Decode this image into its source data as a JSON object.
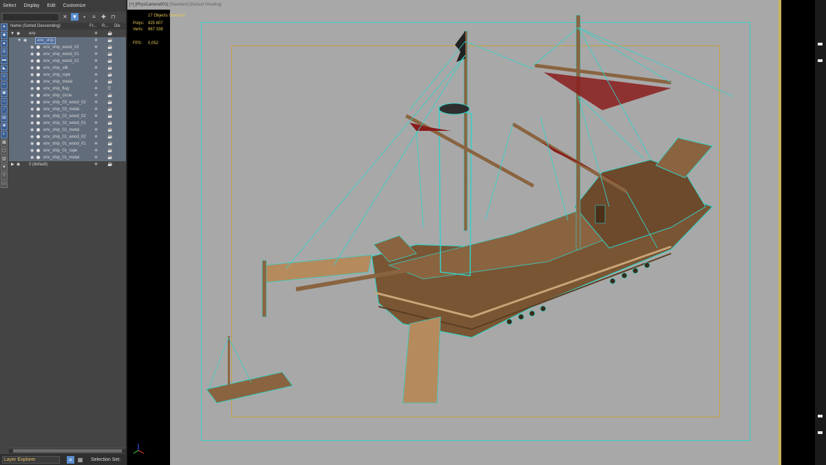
{
  "menu": [
    "Select",
    "Display",
    "Edit",
    "Customize"
  ],
  "columns": {
    "name": "Name (Sorted Descending)",
    "frozen": "Fr...",
    "render": "R...",
    "display": "Dis"
  },
  "tree": [
    {
      "label": "env",
      "level": 0
    },
    {
      "label": "env_ship",
      "level": 1,
      "selected": true
    },
    {
      "label": "env_ship_wood_02",
      "level": 2
    },
    {
      "label": "env_ship_wood_01",
      "level": 2
    },
    {
      "label": "env_ship_wood_01",
      "level": 2
    },
    {
      "label": "env_ship_silk",
      "level": 2
    },
    {
      "label": "env_ship_rope",
      "level": 2
    },
    {
      "label": "env_ship_metal",
      "level": 2
    },
    {
      "label": "env_ship_flag",
      "level": 2
    },
    {
      "label": "env_ship_circle",
      "level": 2
    },
    {
      "label": "env_ship_03_wood_02",
      "level": 2
    },
    {
      "label": "env_ship_03_metal",
      "level": 2
    },
    {
      "label": "env_ship_02_wood_02",
      "level": 2
    },
    {
      "label": "env_ship_02_wood_01",
      "level": 2
    },
    {
      "label": "env_ship_02_metal",
      "level": 2
    },
    {
      "label": "env_ship_01_wood_02",
      "level": 2
    },
    {
      "label": "env_ship_01_wood_01",
      "level": 2
    },
    {
      "label": "env_ship_01_rope",
      "level": 2
    },
    {
      "label": "env_ship_01_metal",
      "level": 2
    },
    {
      "label": "0 (default)",
      "level": 0
    }
  ],
  "status": {
    "explorer": "Layer Explorer",
    "selection_set": "Selection Set:"
  },
  "viewport": {
    "label": "[+] [PhysCamera001]",
    "label2": "[Standard] [Default Shading]",
    "selected": "17 Objects Selected",
    "polys_label": "Polys:",
    "polys": "925 807",
    "verts_label": "Verts:",
    "verts": "867 338",
    "fps_label": "FPS:",
    "fps": "0,052"
  },
  "colors": {
    "wireframe": "#33d1c8",
    "wood": "#7a5533",
    "sail": "#8a1c1c",
    "stats": "#e4c857"
  }
}
